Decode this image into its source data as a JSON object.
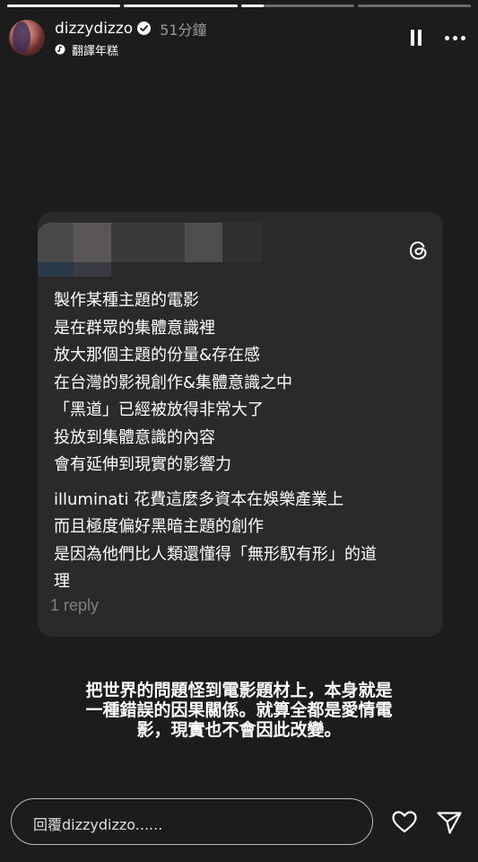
{
  "progress": [
    {
      "fill": 1.0
    },
    {
      "fill": 1.0
    },
    {
      "fill": 0.2
    },
    {
      "fill": 0.0
    }
  ],
  "header": {
    "username": "dizzydizzo",
    "time": "51分鐘",
    "music_label": "翻譯年糕"
  },
  "card": {
    "paragraph1": [
      "製作某種主題的電影",
      "是在群眾的集體意識裡",
      "放大那個主題的份量&存在感",
      "在台灣的影視創作&集體意識之中",
      "「黑道」已經被放得非常大了",
      "投放到集體意識的內容",
      "會有延伸到現實的影響力"
    ],
    "paragraph2": [
      "illuminati 花費這麼多資本在娛樂產業上",
      "而且極度偏好黑暗主題的創作",
      "是因為他們比人類還懂得「無形馭有形」的道",
      "理"
    ],
    "reply_count": "1 reply"
  },
  "caption": [
    "把世界的問題怪到電影題材上，本身就是",
    "一種錯誤的因果關係。就算全都是愛情電",
    "影，現實也不會因此改變。"
  ],
  "footer": {
    "reply_placeholder": "回覆dizzydizzo......"
  },
  "icons": {
    "verified": "verified-badge-icon",
    "music": "music-note-icon",
    "pause": "pause-icon",
    "more": "more-icon",
    "threads": "threads-logo-icon",
    "heart": "heart-icon",
    "send": "send-icon"
  }
}
